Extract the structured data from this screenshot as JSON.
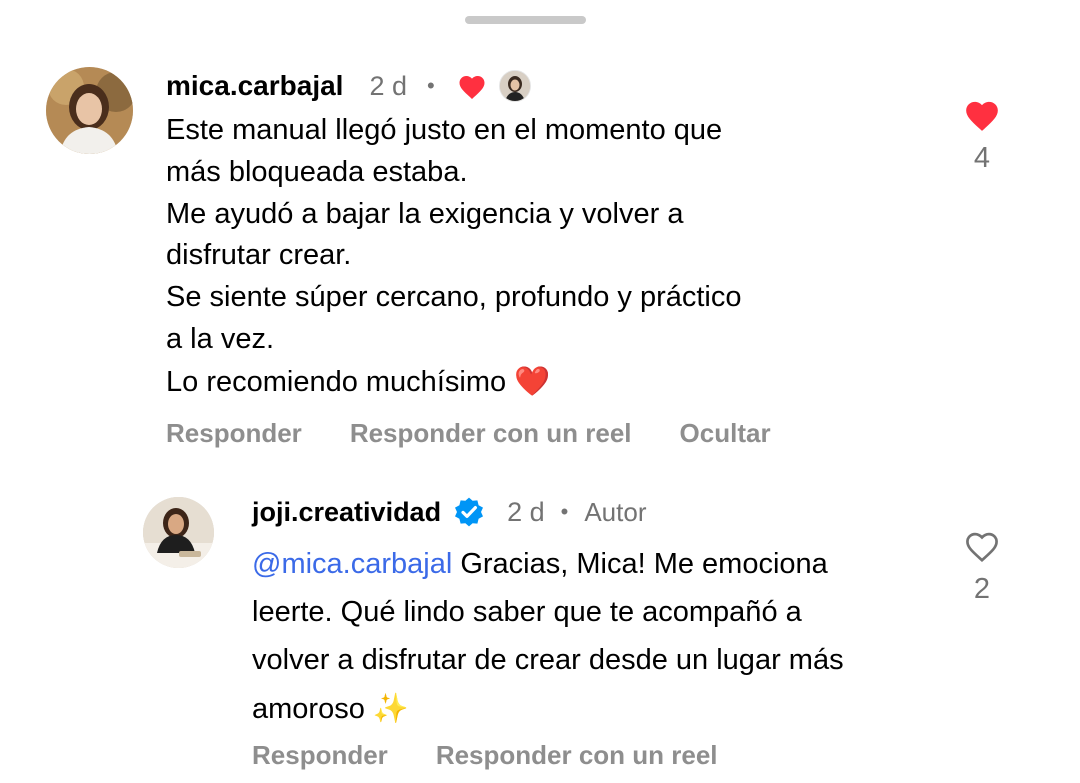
{
  "comment": {
    "username": "mica.carbajal",
    "time": "2 d",
    "separator": "•",
    "liked_by_author_icon": "heart-filled-icon",
    "body_lines": [
      "Este manual llegó justo en el momento que",
      "más bloqueada estaba.",
      "Me ayudó a bajar la exigencia y volver a",
      "disfrutar crear.",
      "Se siente súper cercano, profundo y práctico",
      "a la vez."
    ],
    "body_last_text": "Lo recomiendo muchísimo ",
    "body_last_emoji": "❤️",
    "like_icon": "heart-filled-icon",
    "like_count": "4",
    "actions": {
      "reply": "Responder",
      "reply_reel": "Responder con un reel",
      "hide": "Ocultar"
    }
  },
  "reply": {
    "username": "joji.creatividad",
    "verified_icon": "verified-badge-icon",
    "time": "2 d",
    "separator": "•",
    "author_label": "Autor",
    "mention": "@mica.carbajal",
    "body_line1_text": " Gracias, Mica! Me emociona",
    "body_lines": [
      "leerte. Qué lindo saber que te acompañó a",
      "volver a disfrutar de crear desde un lugar más"
    ],
    "body_last_text": "amoroso ",
    "body_last_emoji": "✨",
    "like_icon": "heart-outline-icon",
    "like_count": "2",
    "actions": {
      "reply": "Responder",
      "reply_reel": "Responder con un reel"
    }
  },
  "colors": {
    "like_red": "#ff3040",
    "secondary_text": "#737373",
    "action_text": "#8e8e8e",
    "mention_blue": "#3b6ae8",
    "verified_blue": "#0095f6"
  }
}
